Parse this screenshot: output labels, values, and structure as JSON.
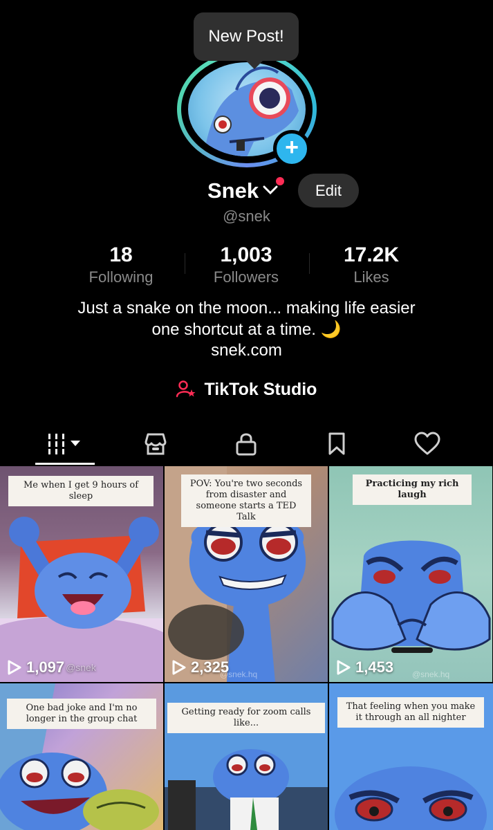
{
  "tooltip": {
    "text": "New Post!"
  },
  "profile": {
    "name": "Snek",
    "handle": "@snek",
    "edit_label": "Edit",
    "bio_line1": "Just a snake on the moon... making life easier",
    "bio_line2": "one shortcut at a time. 🌙",
    "link": "snek.com",
    "studio_label": "TikTok Studio"
  },
  "stats": [
    {
      "value": "18",
      "label": "Following"
    },
    {
      "value": "1,003",
      "label": "Followers"
    },
    {
      "value": "17.2K",
      "label": "Likes"
    }
  ],
  "tabs": [
    "videos-grid",
    "shop",
    "private",
    "saved",
    "liked"
  ],
  "videos": [
    {
      "caption": "Me when I get 9 hours of sleep",
      "views": "1,097",
      "watermark": "@snek"
    },
    {
      "caption": "POV: You're two seconds from disaster and someone starts a TED Talk",
      "views": "2,325",
      "watermark": "@snek.hq"
    },
    {
      "caption": "Practicing my rich laugh",
      "views": "1,453",
      "watermark": "@snek.hq"
    },
    {
      "caption": "One bad joke and I'm no longer in the group chat",
      "views": "",
      "watermark": ""
    },
    {
      "caption": "Getting ready for zoom calls like...",
      "views": "",
      "watermark": ""
    },
    {
      "caption": "That feeling when you make it through an all nighter",
      "views": "",
      "watermark": ""
    }
  ],
  "colors": {
    "accent": "#fe2c55",
    "add_button": "#2eb6ee",
    "background": "#000000",
    "secondary_text": "#8a8a8a"
  }
}
